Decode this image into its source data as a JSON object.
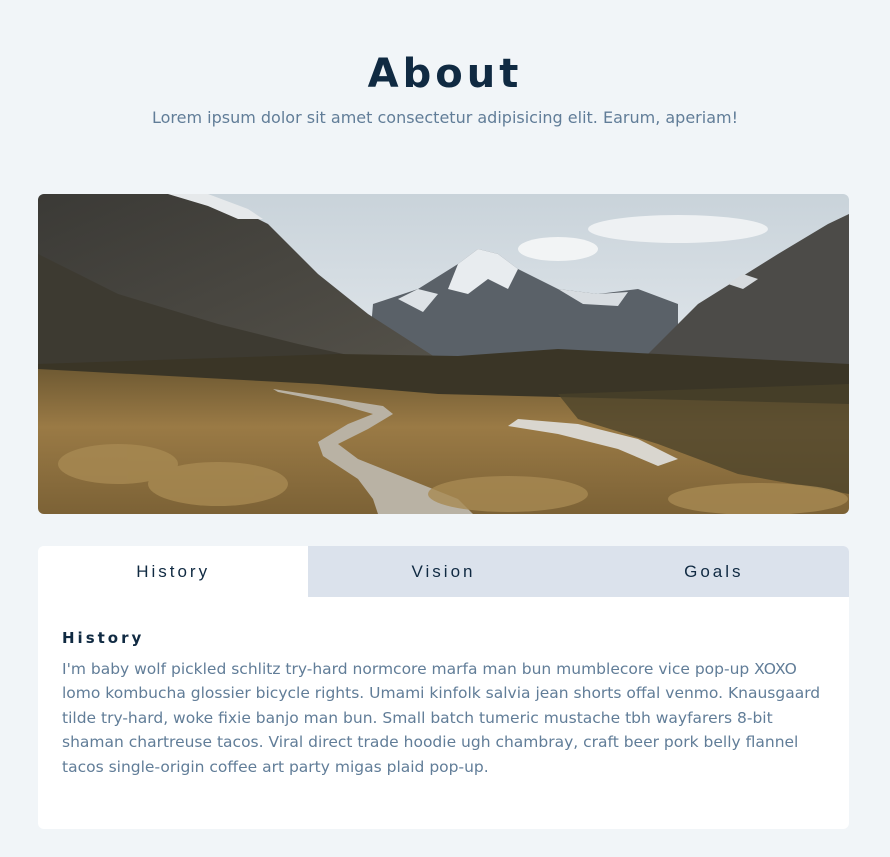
{
  "header": {
    "title": "About",
    "subtitle": "Lorem ipsum dolor sit amet consectetur adipisicing elit. Earum, aperiam!"
  },
  "hero": {
    "icon": "mountain-landscape-photo"
  },
  "tabs": [
    {
      "label": "History",
      "active": true
    },
    {
      "label": "Vision",
      "active": false
    },
    {
      "label": "Goals",
      "active": false
    }
  ],
  "content": {
    "title": "History",
    "text": "I'm baby wolf pickled schlitz try-hard normcore marfa man bun mumblecore vice pop-up XOXO lomo kombucha glossier bicycle rights. Umami kinfolk salvia jean shorts offal venmo. Knausgaard tilde try-hard, woke fixie banjo man bun. Small batch tumeric mustache tbh wayfarers 8-bit shaman chartreuse tacos. Viral direct trade hoodie ugh chambray, craft beer pork belly flannel tacos single-origin coffee art party migas plaid pop-up."
  },
  "colors": {
    "background": "#f1f5f8",
    "title": "#102a42",
    "text": "#617d98",
    "tab_inactive": "#dbe2ec",
    "card": "#ffffff"
  }
}
